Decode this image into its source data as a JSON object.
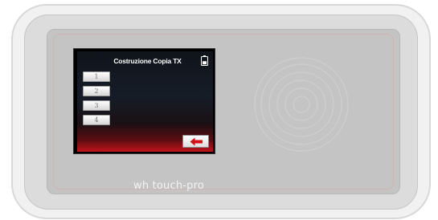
{
  "screen": {
    "title": "Costruzione Copia TX",
    "slots": [
      "1",
      "2",
      "3",
      "4"
    ]
  },
  "icons": {
    "battery": "battery-icon",
    "back": "back-arrow-icon",
    "nfc": "nfc-waves-icon"
  },
  "branding": {
    "logo_text": "wh touch-pro"
  },
  "colors": {
    "back_arrow": "#d40f1a",
    "screen_gradient_bottom": "#c0141a",
    "device_face": "#c4c4c4"
  }
}
